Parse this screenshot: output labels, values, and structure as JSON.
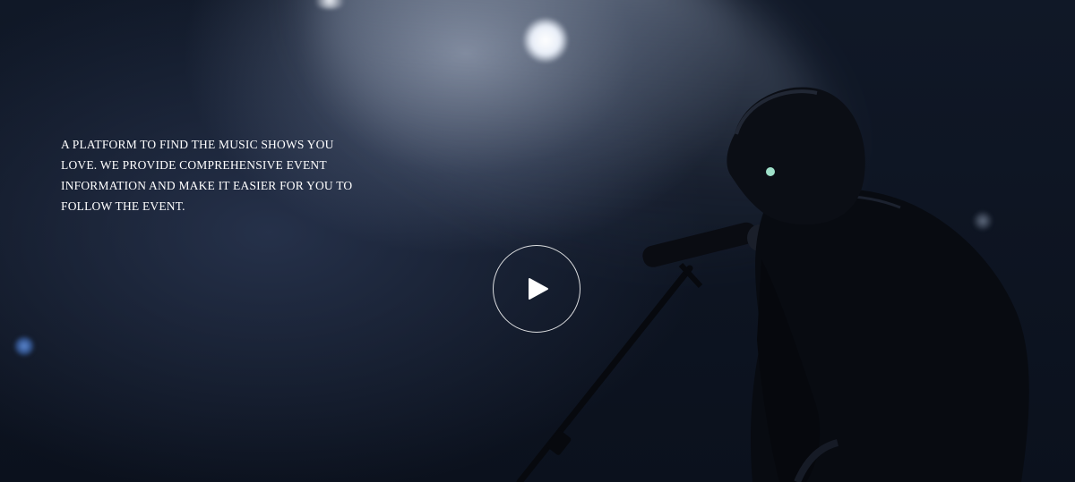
{
  "hero": {
    "tagline": "A PLATFORM TO FIND THE MUSIC SHOWS YOU LOVE. WE PROVIDE COMPREHENSIVE EVENT INFORMATION AND MAKE IT EASIER FOR YOU TO FOLLOW THE EVENT.",
    "background": "singer-at-microphone-under-spotlight",
    "play_icon": "play-icon"
  },
  "colors": {
    "text": "#ffffff",
    "background_dark": "#0e1420",
    "spotlight": "#dfe6f2"
  }
}
